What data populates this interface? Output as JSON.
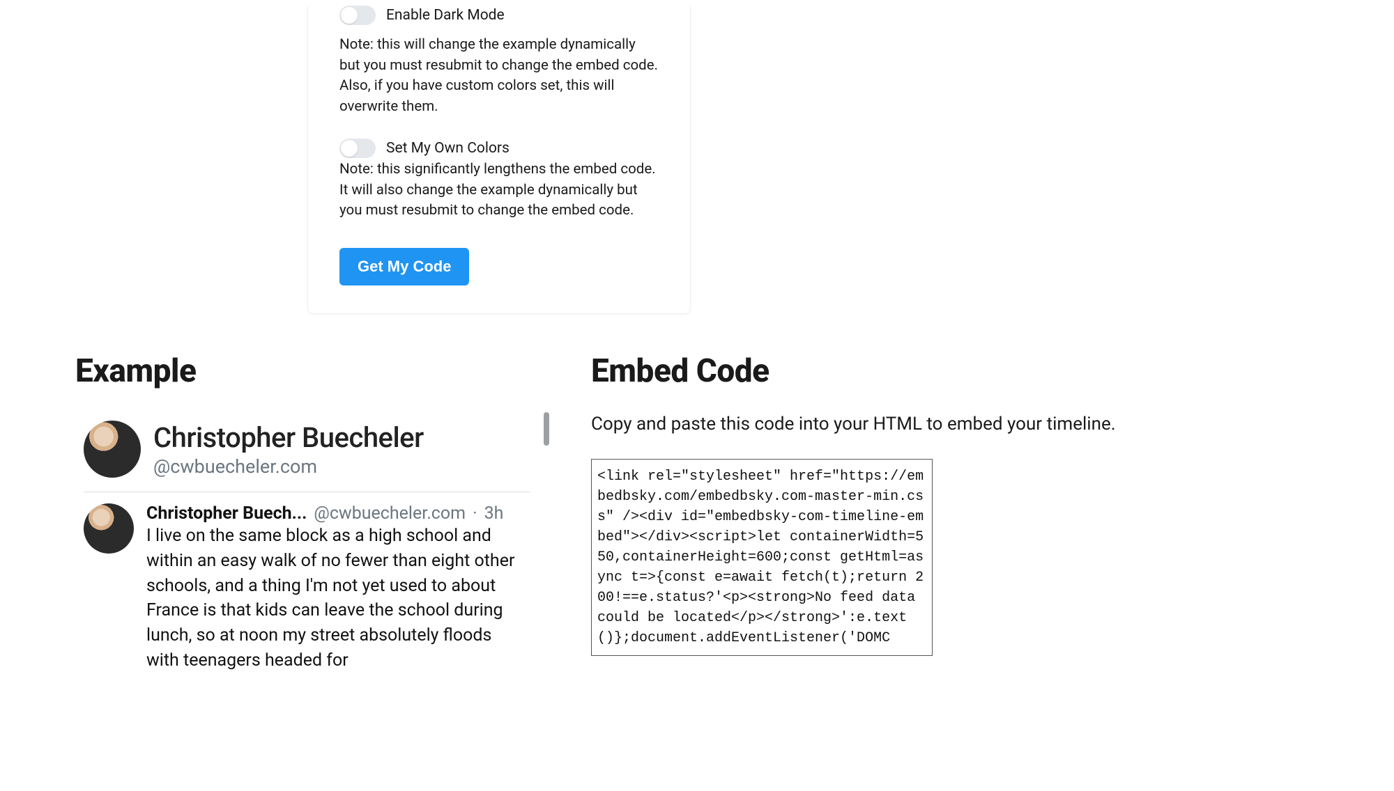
{
  "settings": {
    "darkMode": {
      "label": "Enable Dark Mode",
      "note": "Note: this will change the example dynamically but you must resubmit to change the embed code. Also, if you have custom colors set, this will overwrite them."
    },
    "ownColors": {
      "label": "Set My Own Colors",
      "note": "Note: this significantly lengthens the embed code. It will also change the example dynamically but you must resubmit to change the embed code."
    },
    "submitLabel": "Get My Code"
  },
  "example": {
    "heading": "Example",
    "profile": {
      "name": "Christopher Buecheler",
      "handle": "@cwbuecheler.com"
    },
    "post": {
      "author": "Christopher Buech...",
      "handle": "@cwbuecheler.com",
      "sep": "·",
      "time": "3h",
      "text": "I live on the same block as a high school and within an easy walk of no fewer than eight other schools, and a thing I'm not yet used to about France is that kids can leave the school during lunch, so at noon my street absolutely floods with teenagers headed for"
    }
  },
  "embed": {
    "heading": "Embed Code",
    "desc": "Copy and paste this code into your HTML to embed your timeline.",
    "code": "<link rel=\"stylesheet\" href=\"https://embedbsky.com/embedbsky.com-master-min.css\" /><div id=\"embedbsky-com-timeline-embed\"></div><script>let containerWidth=550,containerHeight=600;const getHtml=async t=>{const e=await fetch(t);return 200!==e.status?'<p><strong>No feed data could be located</p></strong>':e.text()};document.addEventListener('DOMC"
  }
}
